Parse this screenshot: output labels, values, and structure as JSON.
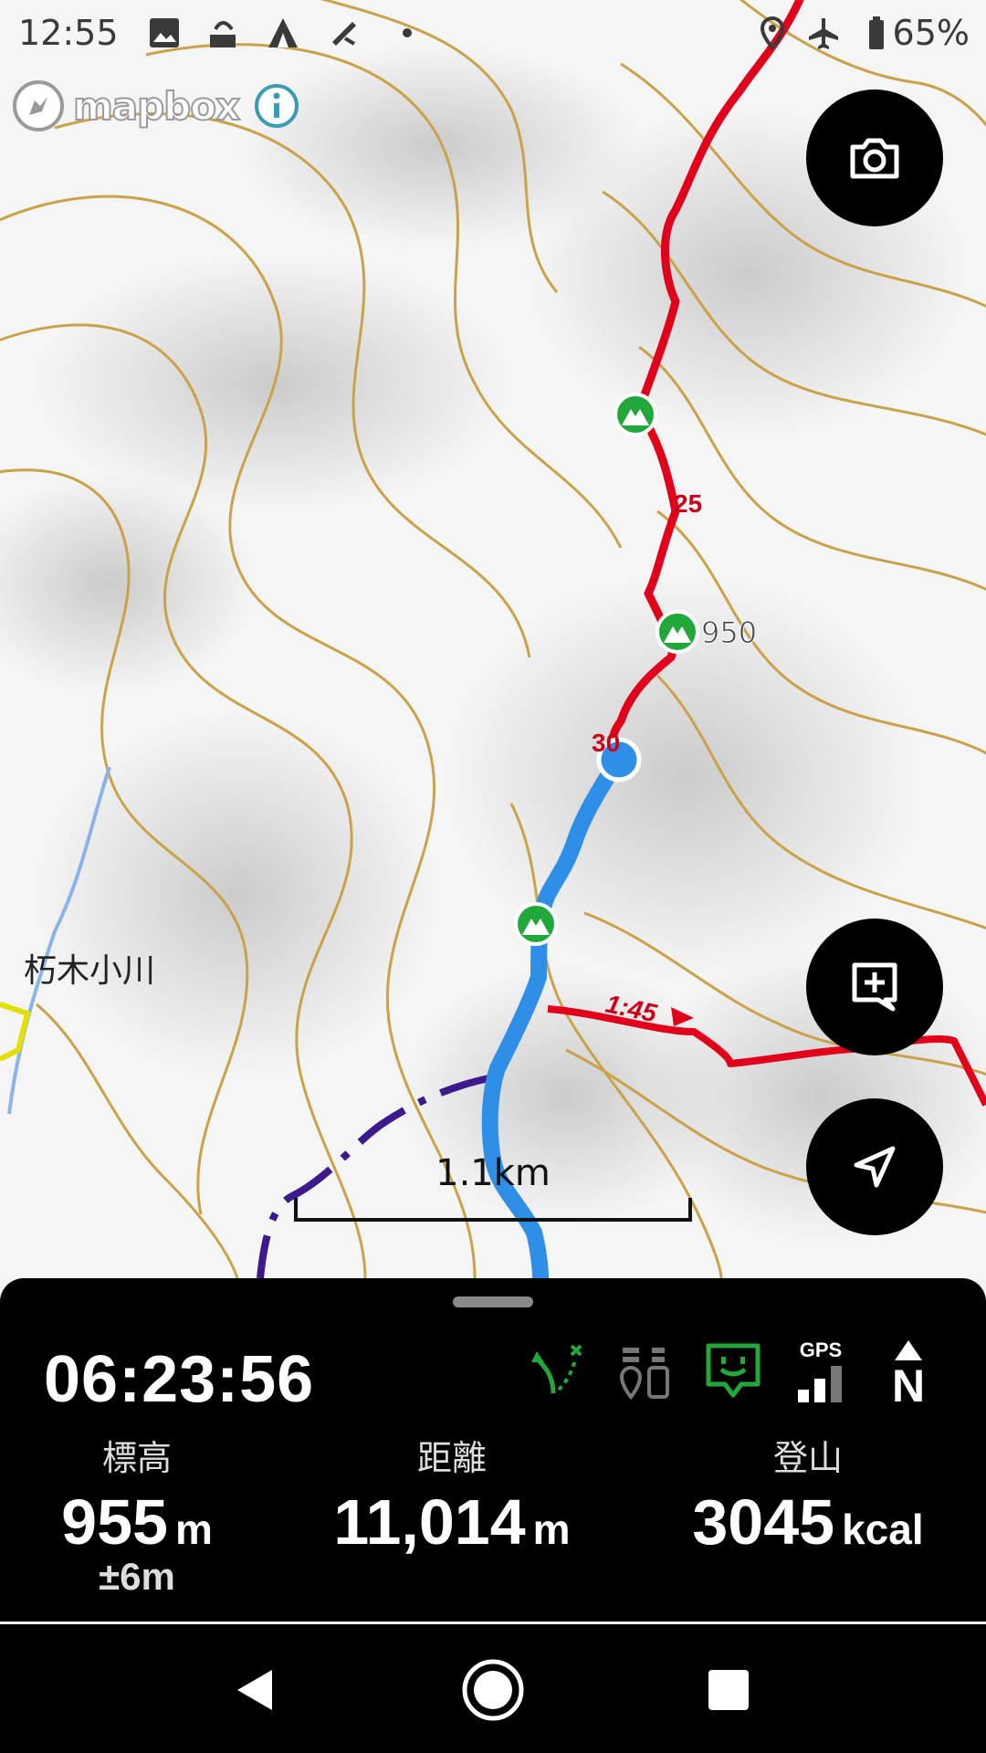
{
  "status_bar": {
    "time": "12:55",
    "battery_percent": "65%",
    "icons": [
      "image-icon",
      "cloud-upload-icon",
      "tent-icon",
      "hiking-icon",
      "dot-icon",
      "location-icon",
      "airplane-icon",
      "battery-icon"
    ]
  },
  "map": {
    "attribution": "mapbox",
    "labels": {
      "route_km_25": "25",
      "route_km_30": "30",
      "peak_elevation": "950",
      "course_time": "1:45",
      "place_name": "朽木小川"
    },
    "scale_label": "1.1km",
    "colors": {
      "planned_route": "#e0001b",
      "walked_track": "#2f8fe6",
      "contour": "#c9a24a",
      "other_trail": "#3c1a8c",
      "checkpoint_green": "#22a83a"
    }
  },
  "buttons": {
    "camera_icon": "camera-icon",
    "add_memo_icon": "add-memo-icon",
    "my_location_icon": "navigation-arrow-icon"
  },
  "panel": {
    "elapsed_time": "06:23:56",
    "status_icons": [
      "route-off-icon",
      "gear-pack-icon",
      "happy-message-icon",
      "gps-signal-icon",
      "north-compass-icon"
    ],
    "gps_label": "GPS",
    "north_label": "N",
    "stats": {
      "elevation": {
        "label": "標高",
        "value": "955",
        "unit": "m",
        "accuracy": "±6m"
      },
      "distance": {
        "label": "距離",
        "value": "11,014",
        "unit": "m"
      },
      "calories": {
        "label": "登山",
        "value": "3045",
        "unit": "kcal"
      }
    }
  }
}
